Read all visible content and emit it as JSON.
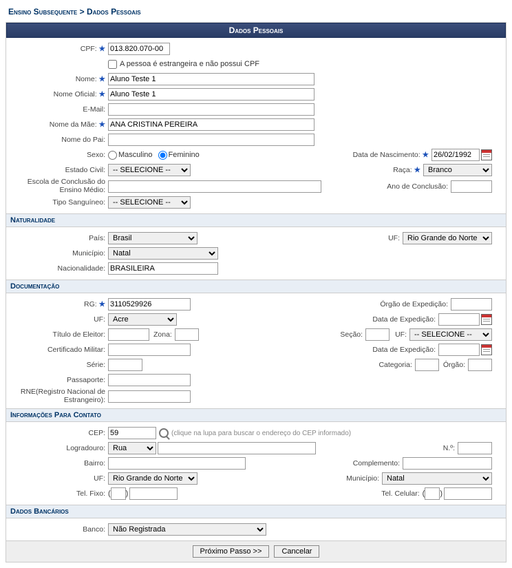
{
  "breadcrumb": {
    "part1": "Ensino Subsequente",
    "sep": ">",
    "part2": "Dados Pessoais"
  },
  "header": {
    "title": "Dados Pessoais"
  },
  "pessoal": {
    "cpf_label": "CPF:",
    "cpf": "013.820.070-00",
    "estrangeira_label": "A pessoa é estrangeira e não possui CPF",
    "nome_label": "Nome:",
    "nome": "Aluno Teste 1",
    "nome_oficial_label": "Nome Oficial:",
    "nome_oficial": "Aluno Teste 1",
    "email_label": "E-Mail:",
    "email": "",
    "nome_mae_label": "Nome da Mãe:",
    "nome_mae": "ANA CRISTINA PEREIRA",
    "nome_pai_label": "Nome do Pai:",
    "nome_pai": "",
    "sexo_label": "Sexo:",
    "sexo_m": "Masculino",
    "sexo_f": "Feminino",
    "data_nasc_label": "Data de Nascimento:",
    "data_nasc": "26/02/1992",
    "estado_civil_label": "Estado Civil:",
    "estado_civil": "-- SELECIONE --",
    "raca_label": "Raça:",
    "raca": "Branco",
    "escola_conc_label": "Escola de Conclusão do Ensino Médio:",
    "escola_conc": "",
    "ano_conc_label": "Ano de Conclusão:",
    "ano_conc": "",
    "tipo_sang_label": "Tipo Sanguíneo:",
    "tipo_sang": "-- SELECIONE --"
  },
  "naturalidade": {
    "header": "Naturalidade",
    "pais_label": "País:",
    "pais": "Brasil",
    "uf_label": "UF:",
    "uf": "Rio Grande do Norte",
    "municipio_label": "Município:",
    "municipio": "Natal",
    "nacionalidade_label": "Nacionalidade:",
    "nacionalidade": "BRASILEIRA"
  },
  "documentacao": {
    "header": "Documentação",
    "rg_label": "RG:",
    "rg": "3110529926",
    "orgao_exp_label": "Órgão de Expedição:",
    "orgao_exp": "",
    "uf_label": "UF:",
    "uf": "Acre",
    "data_exp_label": "Data de Expedição:",
    "data_exp": "",
    "titulo_label": "Título de Eleitor:",
    "titulo": "",
    "zona_label": "Zona:",
    "zona": "",
    "secao_label": "Seção:",
    "secao": "",
    "uf2_label": "UF:",
    "uf2": "-- SELECIONE --",
    "cert_label": "Certificado Militar:",
    "cert": "",
    "data_exp2_label": "Data de Expedição:",
    "data_exp2": "",
    "serie_label": "Série:",
    "serie": "",
    "categoria_label": "Categoria:",
    "categoria": "",
    "orgao2_label": "Órgão:",
    "orgao2": "",
    "passaporte_label": "Passaporte:",
    "passaporte": "",
    "rne_label": "RNE(Registro Nacional de Estrangeiro):",
    "rne": ""
  },
  "contato": {
    "header": "Informações Para Contato",
    "cep_label": "CEP:",
    "cep": "59",
    "cep_hint": "(clique na lupa para buscar o endereço do CEP informado)",
    "logradouro_label": "Logradouro:",
    "logradouro_tipo": "Rua",
    "logradouro": "",
    "numero_label": "N.º:",
    "numero": "",
    "bairro_label": "Bairro:",
    "bairro": "",
    "complemento_label": "Complemento:",
    "complemento": "",
    "uf_label": "UF:",
    "uf": "Rio Grande do Norte",
    "municipio_label": "Município:",
    "municipio": "Natal",
    "tel_fixo_label": "Tel. Fixo:",
    "tel_fixo_ddd": "",
    "tel_fixo": "",
    "tel_cel_label": "Tel. Celular:",
    "tel_cel_ddd": "",
    "tel_cel": ""
  },
  "bancarios": {
    "header": "Dados Bancários",
    "banco_label": "Banco:",
    "banco": "Não Registrada"
  },
  "buttons": {
    "next": "Próximo Passo >>",
    "cancel": "Cancelar"
  }
}
